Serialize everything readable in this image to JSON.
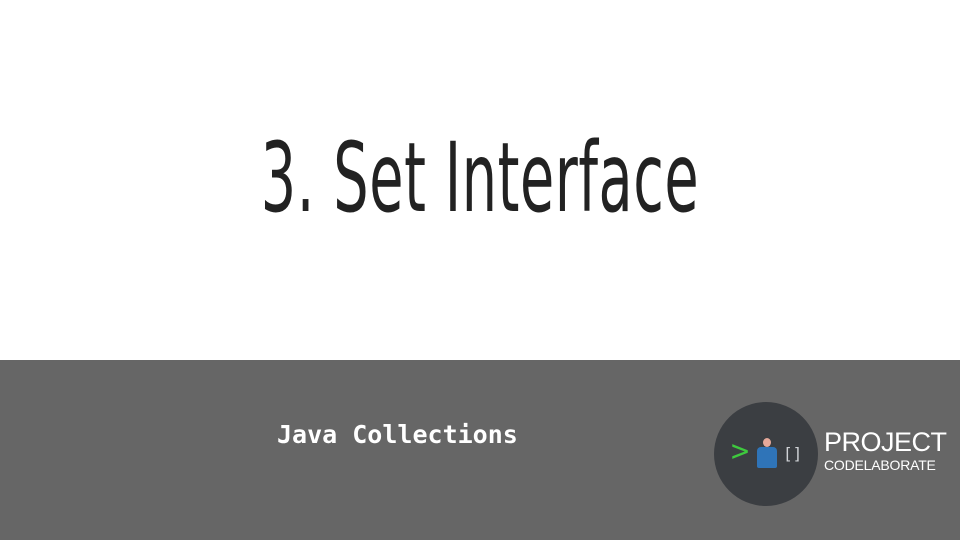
{
  "slide": {
    "title": "3. Set Interface",
    "subtitle": "Java Collections"
  },
  "logo": {
    "prompt_glyph": ">",
    "brackets": "[]",
    "word_primary": "PROJECT",
    "word_secondary": "CODELABORATE",
    "icon": "person-icon"
  },
  "colors": {
    "background": "#ffffff",
    "footer_band": "#666666",
    "title_text": "#222222",
    "logo_circle": "#3b3e42",
    "prompt_green": "#3ec93e",
    "person_body": "#2f74b8",
    "person_head": "#e6a99a"
  }
}
